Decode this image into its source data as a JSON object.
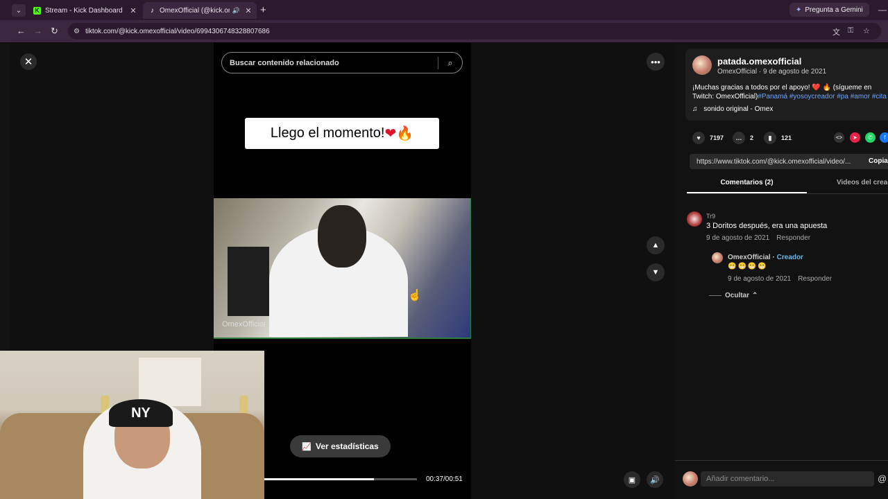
{
  "browser": {
    "tabs": [
      {
        "title": "Stream - Kick Dashboard",
        "favicon": "K"
      },
      {
        "title": "OmexOfficial (@kick.omexo",
        "favicon": "tiktok"
      }
    ],
    "gemini_label": "Pregunta a Gemini",
    "url": "tiktok.com/@kick.omexofficial/video/6994306748328807686"
  },
  "search": {
    "placeholder": "Buscar contenido relacionado"
  },
  "video": {
    "caption": "Llego el momento!",
    "watermark": "OmexOfficial",
    "stats_label": "Ver estadísticas",
    "time": "00:37/00:51",
    "progress": 0.72
  },
  "author": {
    "username": "patada.omexofficial",
    "meta": "OmexOfficial · 9 de agosto de 2021",
    "desc_text": "¡Muchas gracias a todos por el apoyo! ❤️ 🔥 (sígueme en Twitch: OmexOfficial)",
    "tags": [
      "#Panamá",
      "#yosoycreador",
      "#pa",
      "#amor",
      "#cita"
    ],
    "sound": "sonido original - Omex"
  },
  "actions": {
    "likes": "7197",
    "comments": "2",
    "saves": "121"
  },
  "share": {
    "link": "https://www.tiktok.com/@kick.omexofficial/video/...",
    "copy_label": "Copiar"
  },
  "tabs": {
    "comments": "Comentarios (2)",
    "videos": "Videos del creador"
  },
  "comments": [
    {
      "user": "Tr9",
      "text": "3 Doritos después, era una apuesta",
      "date": "9 de agosto de 2021",
      "reply_label": "Responder",
      "replies": [
        {
          "user": "OmexOfficial",
          "badge": "Creador",
          "emojis": "😁😁😁😁",
          "date": "9 de agosto de 2021",
          "reply_label": "Responder"
        }
      ],
      "hide_label": "Ocultar"
    }
  ],
  "add_comment": {
    "placeholder": "Añadir comentario..."
  },
  "colors": {
    "accent_blue": "#69a4ff",
    "creator_blue": "#69b7e8",
    "kick_green": "#53fc18"
  }
}
